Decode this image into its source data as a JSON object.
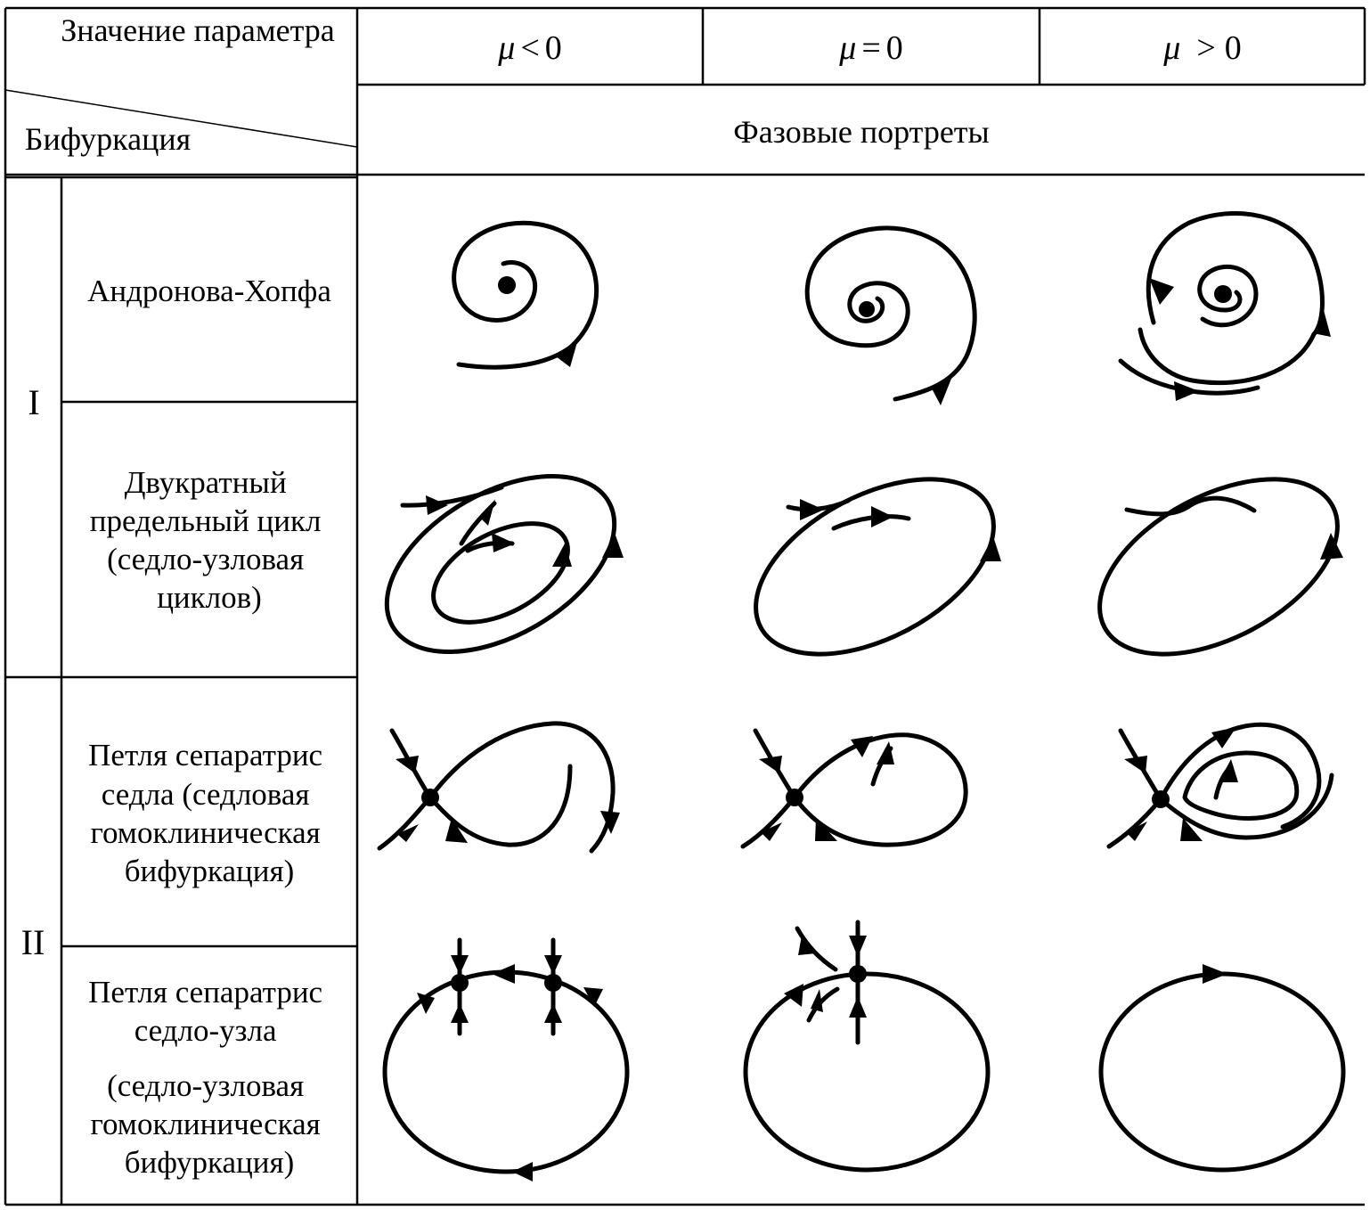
{
  "header": {
    "param_label": "Значение параметра",
    "bif_label": "Бифуркация",
    "portraits_label": "Фазовые портреты",
    "mu_symbol": "μ",
    "columns": [
      {
        "op": "<",
        "value": "0"
      },
      {
        "op": "=",
        "value": "0"
      },
      {
        "op": ">",
        "value": "0"
      }
    ]
  },
  "groups": [
    {
      "label": "I"
    },
    {
      "label": "II"
    }
  ],
  "rows": [
    {
      "lines": [
        "Андронова-Хопфа"
      ]
    },
    {
      "lines": [
        "Двукратный",
        "предельный цикл",
        "(седло-узловая",
        "циклов)"
      ]
    },
    {
      "lines": [
        "Петля сепаратрис",
        "седла (седловая",
        "гомоклиническая",
        "бифуркация)"
      ]
    },
    {
      "lines": [
        "Петля сепаратрис",
        "седло-узла",
        "(седло-узловая",
        "гомоклиническая",
        "бифуркация)"
      ]
    }
  ]
}
